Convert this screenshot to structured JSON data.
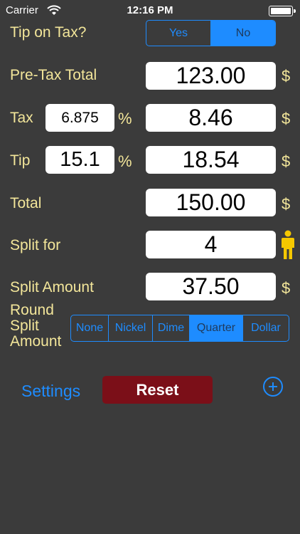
{
  "status": {
    "carrier": "Carrier",
    "time": "12:16 PM"
  },
  "tip_on_tax": {
    "label": "Tip on Tax?",
    "options": [
      "Yes",
      "No"
    ],
    "selected": "No"
  },
  "pretax": {
    "label": "Pre-Tax Total",
    "value": "123.00",
    "unit": "$"
  },
  "tax": {
    "label": "Tax",
    "rate": "6.875",
    "rate_unit": "%",
    "value": "8.46",
    "unit": "$"
  },
  "tip": {
    "label": "Tip",
    "rate": "15.1",
    "rate_unit": "%",
    "value": "18.54",
    "unit": "$"
  },
  "total": {
    "label": "Total",
    "value": "150.00",
    "unit": "$"
  },
  "split_for": {
    "label": "Split for",
    "value": "4"
  },
  "split_amount": {
    "label": "Split Amount",
    "value": "37.50",
    "unit": "$"
  },
  "round": {
    "label_lines": [
      "Round",
      "Split",
      "Amount"
    ],
    "options": [
      "None",
      "Nickel",
      "Dime",
      "Quarter",
      "Dollar"
    ],
    "selected": "Quarter"
  },
  "footer": {
    "settings": "Settings",
    "reset": "Reset"
  },
  "colors": {
    "label": "#f3e69a",
    "accent": "#1e8cff",
    "reset_bg": "#7b0f18",
    "background": "#3b3b3b",
    "person_icon": "#f5c800"
  }
}
